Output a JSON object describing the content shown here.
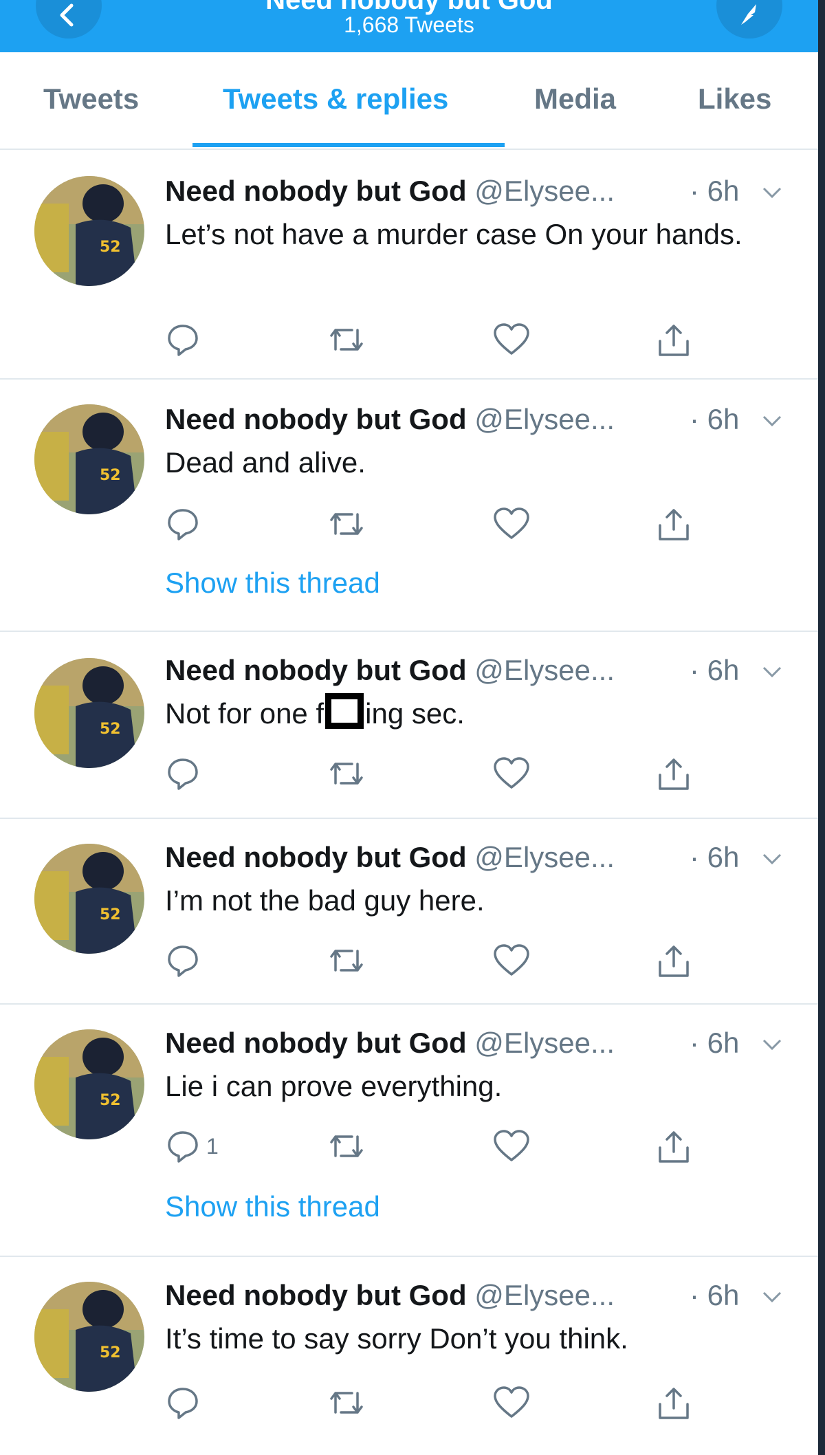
{
  "header": {
    "profile_name": "Need nobody but God",
    "tweet_count": "1,668 Tweets"
  },
  "tabs": [
    {
      "label": "Tweets"
    },
    {
      "label": "Tweets & replies",
      "active": true
    },
    {
      "label": "Media"
    },
    {
      "label": "Likes"
    }
  ],
  "tweets": [
    {
      "name": "Need nobody but God",
      "handle": "@Elysee...",
      "time": "· 6h",
      "text": "Let’s not have a murder case On your hands."
    },
    {
      "name": "Need nobody but God",
      "handle": "@Elysee...",
      "time": "· 6h",
      "text": "Dead and alive.",
      "thread_link": "Show this thread"
    },
    {
      "name": "Need nobody but God",
      "handle": "@Elysee...",
      "time": "· 6h",
      "text_before": "Not for one f",
      "text_after": "ing sec."
    },
    {
      "name": "Need nobody but God",
      "handle": "@Elysee...",
      "time": "· 6h",
      "text": "I’m not the bad guy here."
    },
    {
      "name": "Need nobody but God",
      "handle": "@Elysee...",
      "time": "· 6h",
      "text": "Lie i can prove everything.",
      "reply_count": "1",
      "thread_link": "Show this thread"
    },
    {
      "name": "Need nobody but God",
      "handle": "@Elysee...",
      "time": "· 6h",
      "text": "It’s time to say sorry Don’t you think."
    }
  ],
  "colors": {
    "accent": "#1da1f2",
    "text": "#14171a",
    "muted": "#657786"
  }
}
